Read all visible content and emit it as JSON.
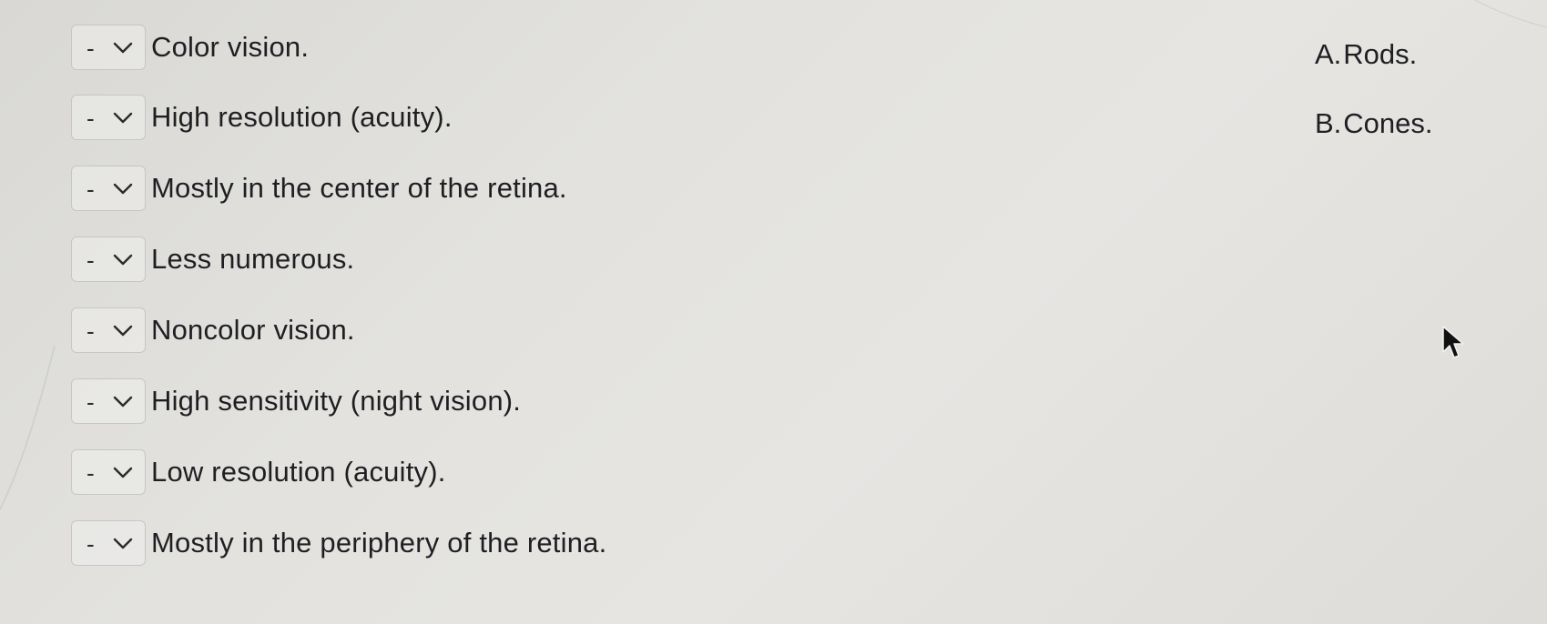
{
  "questions": [
    {
      "text": "Color vision.",
      "selected": "-"
    },
    {
      "text": "High resolution (acuity).",
      "selected": "-"
    },
    {
      "text": "Mostly in the center of the retina.",
      "selected": "-"
    },
    {
      "text": "Less numerous.",
      "selected": "-"
    },
    {
      "text": "Noncolor vision.",
      "selected": "-"
    },
    {
      "text": "High sensitivity (night vision).",
      "selected": "-"
    },
    {
      "text": "Low resolution (acuity).",
      "selected": "-"
    },
    {
      "text": "Mostly in the periphery of the retina.",
      "selected": "-"
    }
  ],
  "answers": [
    {
      "letter": "A.",
      "text": "Rods."
    },
    {
      "letter": "B.",
      "text": "Cones."
    }
  ],
  "icons": {
    "dropdown": "chevron-down-icon",
    "cursor": "mouse-pointer-icon"
  },
  "colors": {
    "background": "#e3e2de",
    "text": "#1f1f23",
    "dropdown_border": "#c6c6c8"
  }
}
